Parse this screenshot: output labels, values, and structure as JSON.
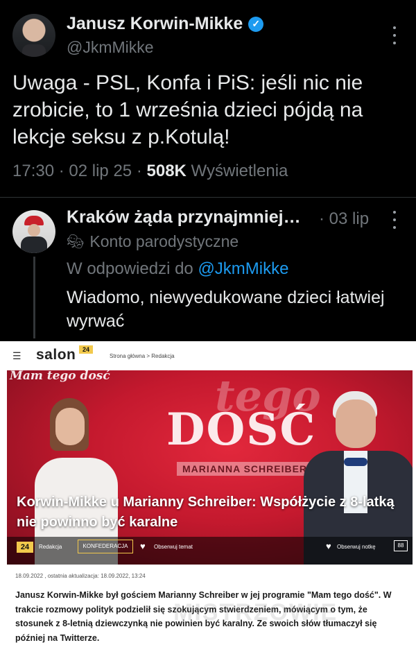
{
  "tweet": {
    "author_name": "Janusz Korwin-Mikke",
    "handle": "@JkmMikke",
    "text": "Uwaga - PSL, Konfa i PiS: jeśli nic nie zrobicie, to 1 września dzieci pójdą na lekcje seksu z p.Kotulą!",
    "time": "17:30",
    "date": "02 lip 25",
    "views_count": "508K",
    "views_label": "Wyświetlenia",
    "verified_icon": "check-badge"
  },
  "reply": {
    "author_name": "Kraków żąda przynajmniej…",
    "date": "03 lip",
    "account_label": "Konto parodystyczne",
    "reply_prefix": "W odpowiedzi do",
    "reply_handle": "@JkmMikke",
    "text": "Wiadomo, niewyedukowane dzieci łatwiej wyrwać"
  },
  "salon": {
    "logo": "salon",
    "logo_badge": "24",
    "breadcrumb": "Strona główna  > Redakcja",
    "hero": {
      "show_script": "tego",
      "show_big": "DOSĆ",
      "show_corner": "Mam tego dosć",
      "show_guest": "MARIANNA SCHREIBER",
      "title": "Korwin-Mikke u Marianny Schreiber: Współżycie z 8-latką nie powinno być karalne"
    },
    "bar": {
      "badge": "24",
      "author": "Redakcja",
      "tag": "KONFEDERACJA",
      "follow_topic": "Obserwuj temat",
      "follow_note": "Obserwuj notkę",
      "comments": "88"
    },
    "date_line": "18.09.2022 , ostatnia aktualizacja: 18.09.2022, 13:24",
    "article": "Janusz Korwin-Mikke był gościem Marianny Schreiber w jej programie \"Mam tego dość\". W trakcie rozmowy polityk podzielił się szokującym stwierdzeniem, mówiącym o tym, że stosunek z 8-letnią dziewczynką nie powinien być karalny. Ze swoich słów tłumaczył się później na Twitterze.",
    "watermark": "MISTRZOWIE"
  },
  "colors": {
    "twitter_bg": "#000000",
    "twitter_blue": "#1d9bf0",
    "muted": "#71767b",
    "salon_yellow": "#f2c94c",
    "hero_red": "#c4192e"
  }
}
